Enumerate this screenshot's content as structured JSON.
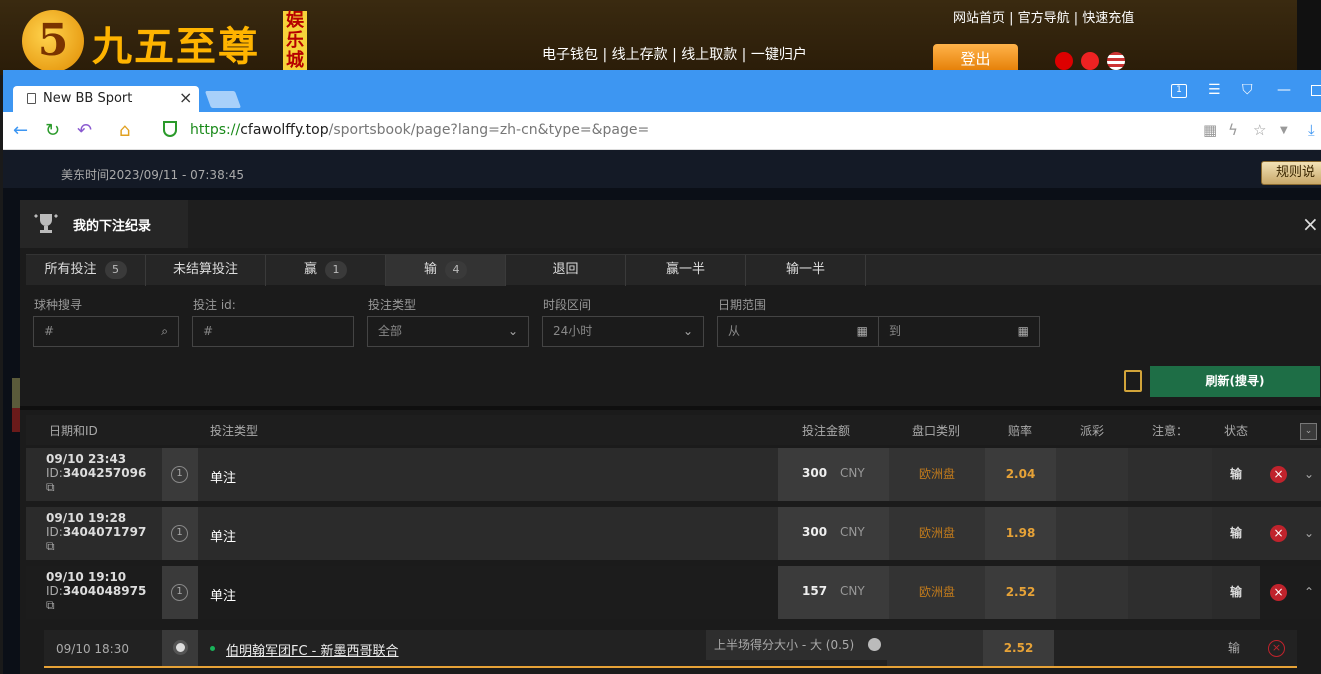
{
  "site": {
    "logo_glyph": "5",
    "logo_text": "九五至尊",
    "logo_tag": "娱乐城",
    "top_links": "网站首页 | 官方导航 | 快速充值",
    "main_links": "电子钱包 | 线上存款 | 线上取款 | 一键归户",
    "logout_label": "登出",
    "colors": {
      "gold": "#ffb400",
      "login": "#e27a00"
    }
  },
  "browser": {
    "tab_title": "New BB Sport",
    "tab_close": "×",
    "url_scheme": "https://",
    "url_host": "cfawolffy.top",
    "url_path": "/sportsbook/page?lang=zh-cn&type=&page=",
    "colors": {
      "tab_bar": "#3d96f2"
    }
  },
  "page": {
    "east_time": "美东时间2023/09/11 - 07:38:45",
    "rules_label": "规则说"
  },
  "modal": {
    "title": "我的下注纪录",
    "close": "×",
    "tabs": [
      {
        "label": "所有投注",
        "count": "5"
      },
      {
        "label": "未结算投注",
        "count": ""
      },
      {
        "label": "赢",
        "count": "1"
      },
      {
        "label": "输",
        "count": "4"
      },
      {
        "label": "退回",
        "count": ""
      },
      {
        "label": "赢一半",
        "count": ""
      },
      {
        "label": "输一半",
        "count": ""
      }
    ],
    "filters": {
      "sport_label": "球种搜寻",
      "sport_placeholder": "#",
      "betid_label": "投注 id:",
      "betid_placeholder": "#",
      "bettype_label": "投注类型",
      "bettype_value": "全部",
      "period_label": "时段区间",
      "period_value": "24小时",
      "date_label": "日期范围",
      "date_from": "从",
      "date_to": "到"
    },
    "refresh_label": "刷新(搜寻)",
    "columns": {
      "date_id": "日期和ID",
      "bet_type": "投注类型",
      "amount": "投注金额",
      "market": "盘口类别",
      "odds": "赔率",
      "payout": "派彩",
      "note": "注意：",
      "status": "状态"
    },
    "rows": [
      {
        "date": "09/10 23:43",
        "id_prefix": "ID:",
        "id": "3404257096",
        "num": "1",
        "type": "单注",
        "amount": "300",
        "currency": "CNY",
        "market": "欧洲盘",
        "odds": "2.04",
        "status": "输",
        "expand": "⌄"
      },
      {
        "date": "09/10 19:28",
        "id_prefix": "ID:",
        "id": "3404071797",
        "num": "1",
        "type": "单注",
        "amount": "300",
        "currency": "CNY",
        "market": "欧洲盘",
        "odds": "1.98",
        "status": "输",
        "expand": "⌄"
      },
      {
        "date": "09/10 19:10",
        "id_prefix": "ID:",
        "id": "3404048975",
        "num": "1",
        "type": "单注",
        "amount": "157",
        "currency": "CNY",
        "market": "欧洲盘",
        "odds": "2.52",
        "status": "输",
        "expand": "⌃"
      }
    ],
    "detail": {
      "date": "09/10 18:30",
      "match": "伯明翰军团FC - 新墨西哥联合",
      "bet": "上半场得分大小 - 大 (0.5)",
      "odds": "2.52",
      "status": "输"
    },
    "colors": {
      "odds": "#e6a237",
      "market": "#c07a1c",
      "refresh": "#1e6e46",
      "lose_x": "#c0232c"
    }
  }
}
